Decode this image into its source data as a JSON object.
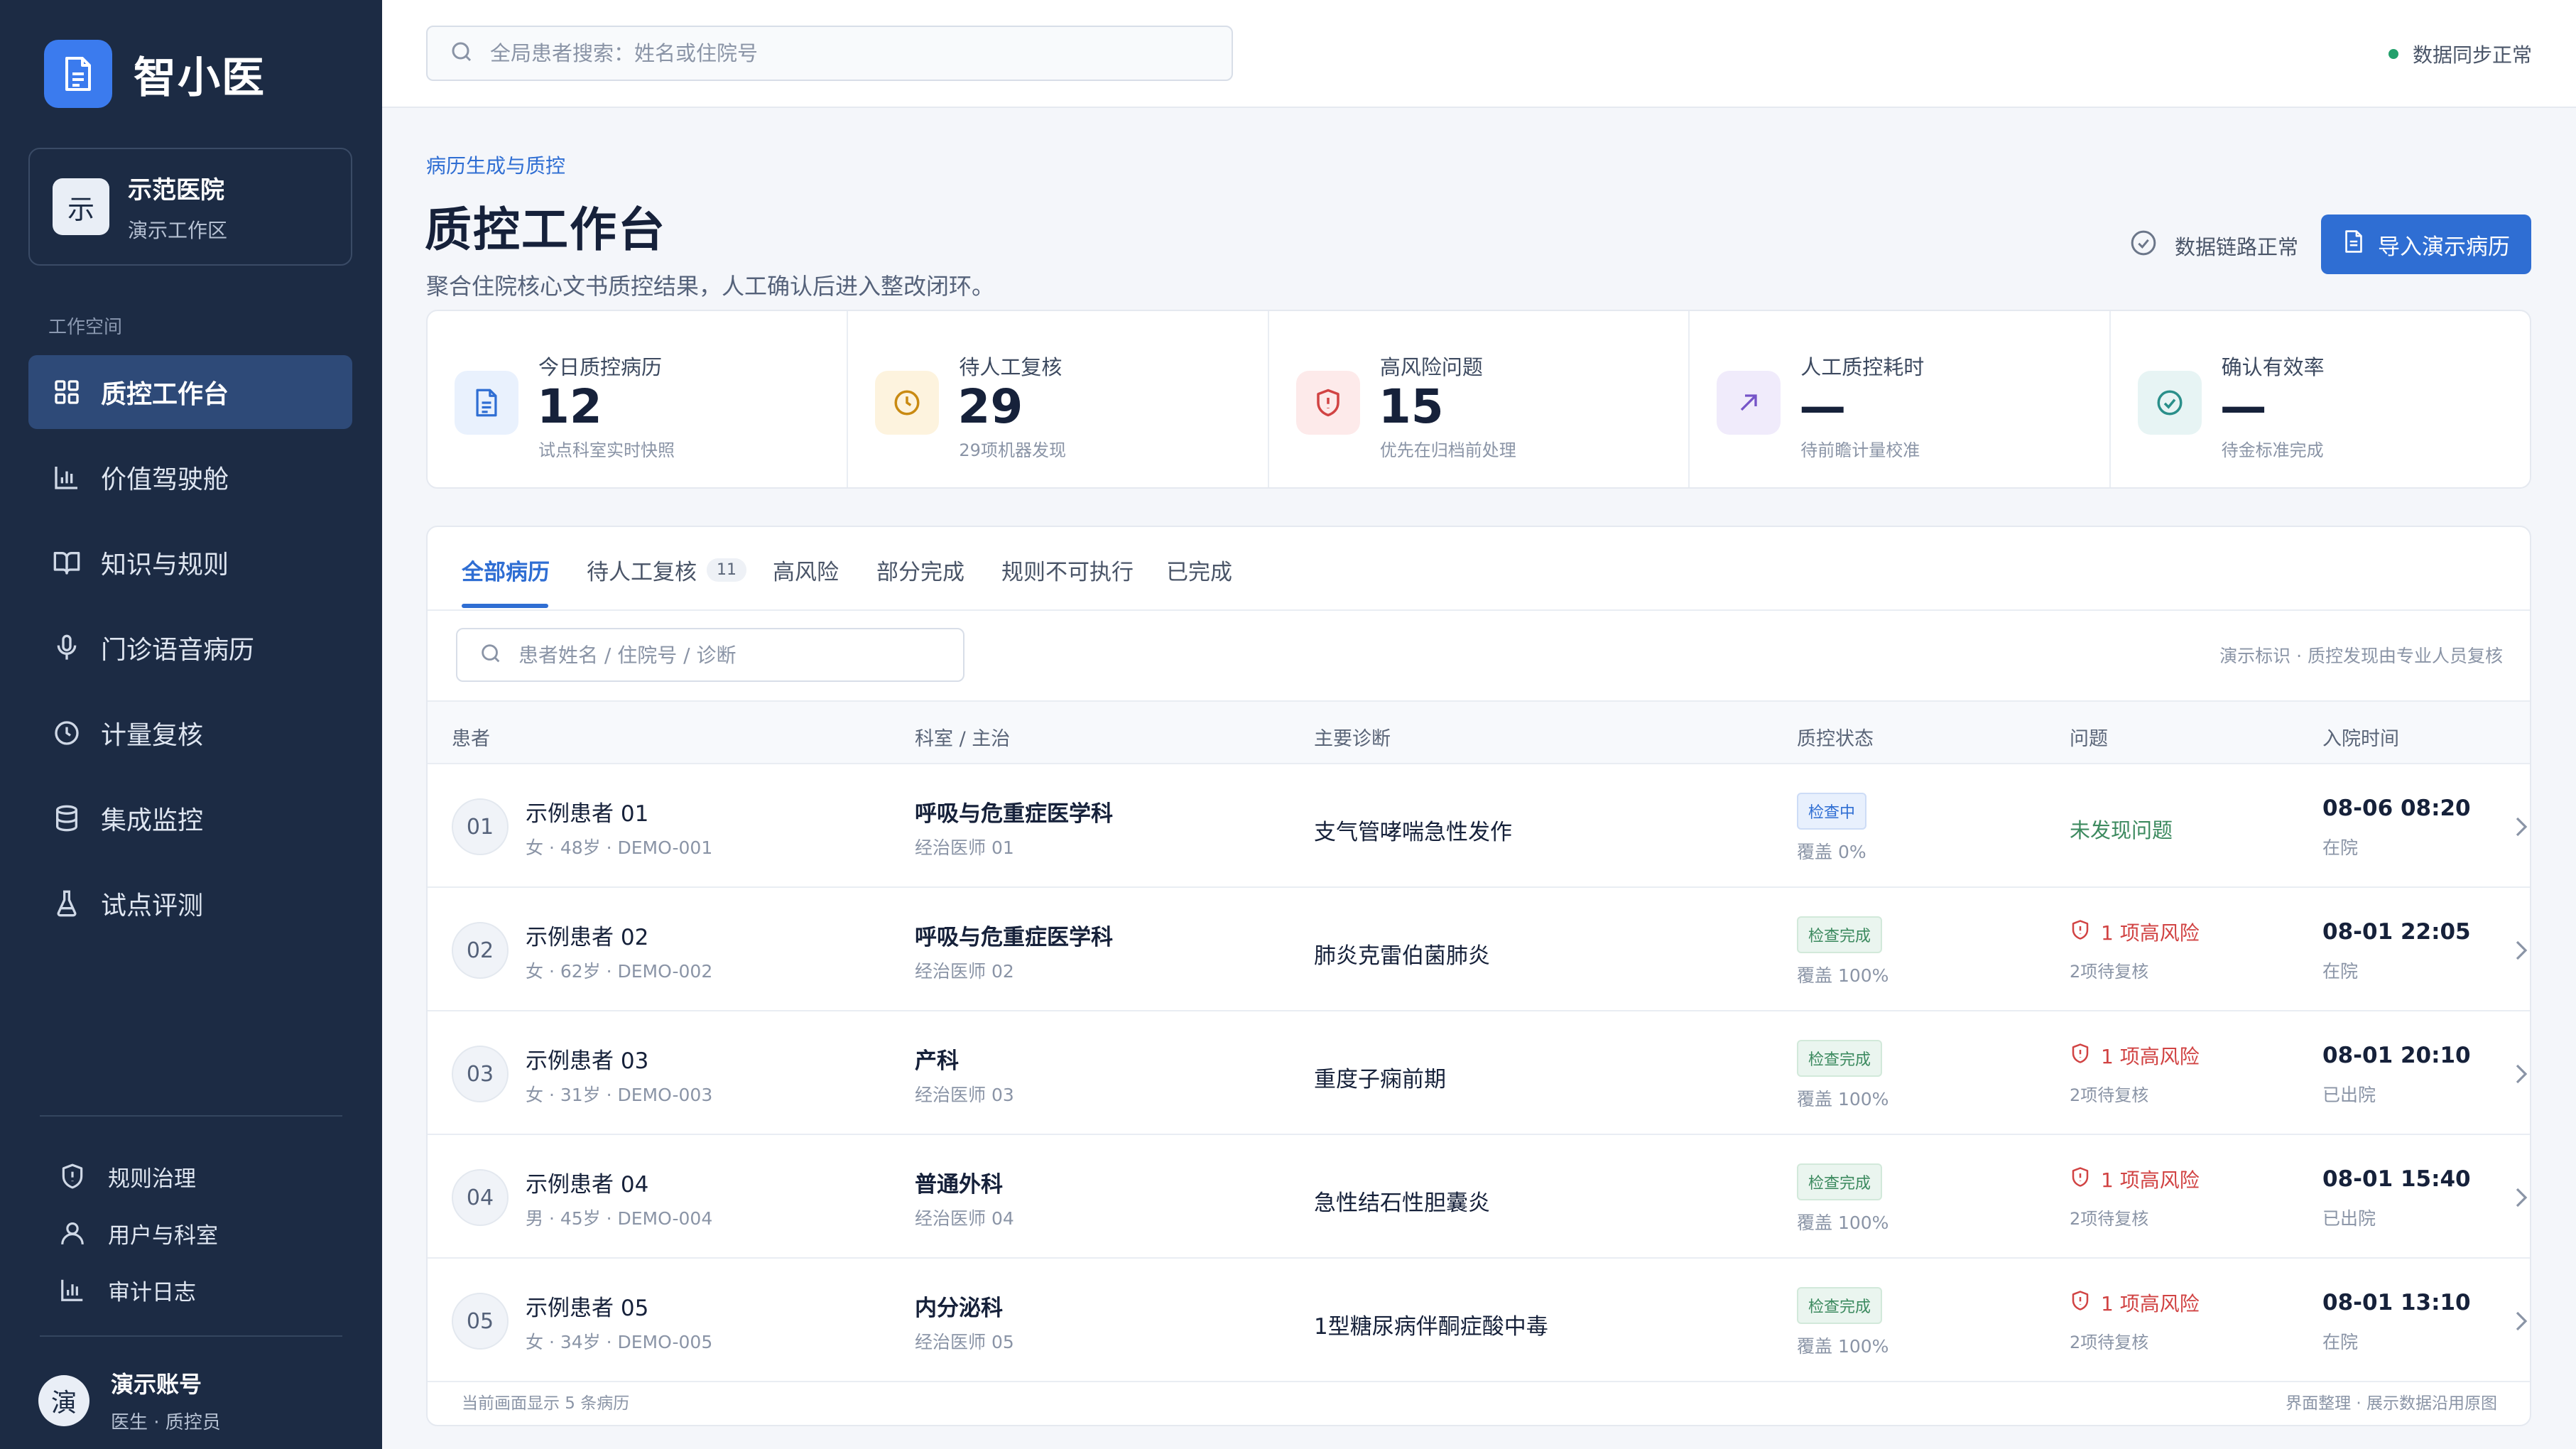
{
  "brand": {
    "name": "智小医"
  },
  "org": {
    "avatar": "示",
    "name": "示范医院",
    "workspace": "演示工作区"
  },
  "sidebar": {
    "section_label": "工作空间",
    "items": [
      {
        "label": "质控工作台",
        "icon": "grid-icon",
        "active": true
      },
      {
        "label": "价值驾驶舱",
        "icon": "bar-chart-icon"
      },
      {
        "label": "知识与规则",
        "icon": "book-icon"
      },
      {
        "label": "门诊语音病历",
        "icon": "microphone-icon"
      },
      {
        "label": "计量复核",
        "icon": "clock-icon"
      },
      {
        "label": "集成监控",
        "icon": "database-icon"
      },
      {
        "label": "试点评测",
        "icon": "flask-icon"
      }
    ],
    "sub_items": [
      {
        "label": "规则治理",
        "icon": "shield-icon"
      },
      {
        "label": "用户与科室",
        "icon": "user-icon"
      },
      {
        "label": "审计日志",
        "icon": "bar-chart-icon"
      }
    ]
  },
  "account": {
    "avatar": "演",
    "name": "演示账号",
    "role": "医生 · 质控员"
  },
  "topbar": {
    "search_placeholder": "全局患者搜索：姓名或住院号",
    "sync_status": "数据同步正常",
    "sync_color": "#22a06b"
  },
  "header": {
    "breadcrumb": "病历生成与质控",
    "title": "质控工作台",
    "description": "聚合住院核心文书质控结果，人工确认后进入整改闭环。",
    "link_status": "数据链路正常",
    "import_button": "导入演示病历"
  },
  "stats": [
    {
      "label": "今日质控病历",
      "value": "12",
      "sub": "试点科室实时快照",
      "icon": "document-icon",
      "bg": "#e9f1fd",
      "color": "#2f6ed3"
    },
    {
      "label": "待人工复核",
      "value": "29",
      "sub": "29项机器发现",
      "icon": "clock-icon",
      "bg": "#fdf3de",
      "color": "#c98a12"
    },
    {
      "label": "高风险问题",
      "value": "15",
      "sub": "优先在归档前处理",
      "icon": "shield-alert-icon",
      "bg": "#fdeaea",
      "color": "#d14343"
    },
    {
      "label": "人工质控耗时",
      "value": "—",
      "sub": "待前瞻计量校准",
      "icon": "arrow-up-right-icon",
      "bg": "#f0ebfb",
      "color": "#7654c8"
    },
    {
      "label": "确认有效率",
      "value": "—",
      "sub": "待金标准完成",
      "icon": "check-circle-icon",
      "bg": "#e7f4f4",
      "color": "#2a8f8a"
    }
  ],
  "tabs": [
    {
      "label": "全部病历",
      "active": true
    },
    {
      "label": "待人工复核",
      "count": "11"
    },
    {
      "label": "高风险"
    },
    {
      "label": "部分完成"
    },
    {
      "label": "规则不可执行"
    },
    {
      "label": "已完成"
    }
  ],
  "table": {
    "search_placeholder": "患者姓名 / 住院号 / 诊断",
    "demo_note": "演示标识 · 质控发现由专业人员复核",
    "columns": [
      "患者",
      "科室 / 主治",
      "主要诊断",
      "质控状态",
      "问题",
      "入院时间"
    ],
    "rows": [
      {
        "num": "01",
        "name": "示例患者 01",
        "meta": "女 · 48岁 · DEMO-001",
        "dept": "呼吸与危重症医学科",
        "doctor": "经治医师 01",
        "diagnosis": "支气管哮喘急性发作",
        "status": "检查中",
        "status_type": "checking",
        "coverage": "覆盖 0%",
        "issue": "未发现问题",
        "issue_type": "ok",
        "issue_sub": "",
        "time": "08-06 08:20",
        "stay": "在院"
      },
      {
        "num": "02",
        "name": "示例患者 02",
        "meta": "女 · 62岁 · DEMO-002",
        "dept": "呼吸与危重症医学科",
        "doctor": "经治医师 02",
        "diagnosis": "肺炎克雷伯菌肺炎",
        "status": "检查完成",
        "status_type": "done",
        "coverage": "覆盖 100%",
        "issue": "1 项高风险",
        "issue_type": "risk",
        "issue_sub": "2项待复核",
        "time": "08-01 22:05",
        "stay": "在院"
      },
      {
        "num": "03",
        "name": "示例患者 03",
        "meta": "女 · 31岁 · DEMO-003",
        "dept": "产科",
        "doctor": "经治医师 03",
        "diagnosis": "重度子痫前期",
        "status": "检查完成",
        "status_type": "done",
        "coverage": "覆盖 100%",
        "issue": "1 项高风险",
        "issue_type": "risk",
        "issue_sub": "2项待复核",
        "time": "08-01 20:10",
        "stay": "已出院"
      },
      {
        "num": "04",
        "name": "示例患者 04",
        "meta": "男 · 45岁 · DEMO-004",
        "dept": "普通外科",
        "doctor": "经治医师 04",
        "diagnosis": "急性结石性胆囊炎",
        "status": "检查完成",
        "status_type": "done",
        "coverage": "覆盖 100%",
        "issue": "1 项高风险",
        "issue_type": "risk",
        "issue_sub": "2项待复核",
        "time": "08-01 15:40",
        "stay": "已出院"
      },
      {
        "num": "05",
        "name": "示例患者 05",
        "meta": "女 · 34岁 · DEMO-005",
        "dept": "内分泌科",
        "doctor": "经治医师 05",
        "diagnosis": "1型糖尿病伴酮症酸中毒",
        "status": "检查完成",
        "status_type": "done",
        "coverage": "覆盖 100%",
        "issue": "1 项高风险",
        "issue_type": "risk",
        "issue_sub": "2项待复核",
        "time": "08-01 13:10",
        "stay": "在院"
      }
    ],
    "footer_left": "当前画面显示 5 条病历",
    "footer_right": "界面整理 · 展示数据沿用原图"
  }
}
